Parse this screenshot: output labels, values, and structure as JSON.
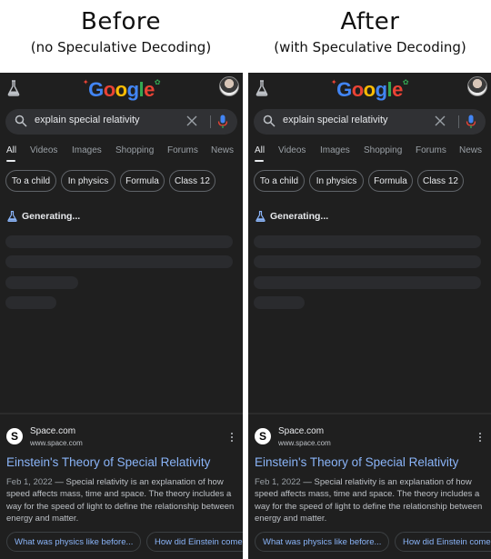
{
  "headers": {
    "left": {
      "title": "Before",
      "subtitle": "(no Speculative Decoding)"
    },
    "right": {
      "title": "After",
      "subtitle": "(with Speculative Decoding)"
    }
  },
  "phone": {
    "logo_letters": [
      "G",
      "o",
      "o",
      "g",
      "l",
      "e"
    ],
    "search": {
      "query": "explain special relativity"
    },
    "tabs": [
      "All",
      "Videos",
      "Images",
      "Shopping",
      "Forums",
      "News"
    ],
    "chips": [
      "To a child",
      "In physics",
      "Formula",
      "Class 12"
    ],
    "generating": "Generating...",
    "result": {
      "site_initial": "S",
      "site_name": "Space.com",
      "site_url": "www.space.com",
      "title": "Einstein's Theory of Special Relativity",
      "date": "Feb 1, 2022",
      "snippet": " — Special relativity is an explanation of how speed affects mass, time and space. The theory includes a way for the speed of light to define the relationship between energy and matter."
    },
    "related": [
      "What was physics like before...",
      "How did Einstein come"
    ]
  },
  "colors": {
    "background": "#1f1f1f",
    "link": "#8ab4f8",
    "mic_blue": "#4285f4",
    "mic_red": "#ea4335"
  },
  "icons": {
    "labs": "flask-icon",
    "search": "search-icon",
    "clear": "close-icon",
    "voice": "microphone-icon",
    "more": "more-vert-icon"
  }
}
